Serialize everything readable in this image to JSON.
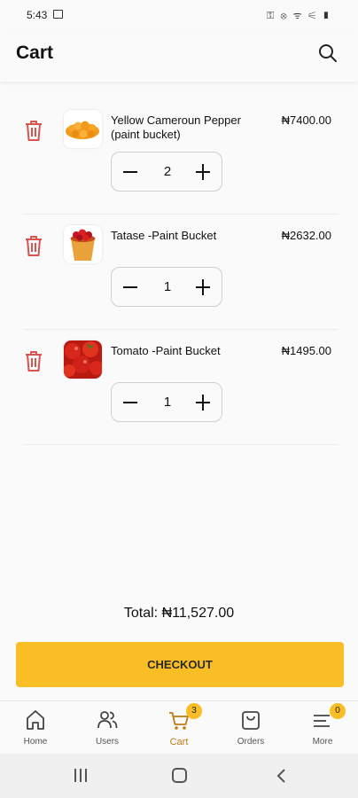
{
  "status_bar": {
    "time": "5:43",
    "right_icons": "⚿ ⊗ ᯤ ⚟ ▮"
  },
  "header": {
    "title": "Cart"
  },
  "cart": {
    "items": [
      {
        "name": "Yellow Cameroun Pepper (paint bucket)",
        "price": "₦7400.00",
        "quantity": "2"
      },
      {
        "name": "Tatase -Paint Bucket",
        "price": "₦2632.00",
        "quantity": "1"
      },
      {
        "name": "Tomato -Paint Bucket",
        "price": "₦1495.00",
        "quantity": "1"
      }
    ]
  },
  "summary": {
    "total": "Total: ₦11,527.00"
  },
  "checkout_label": "CHECKOUT",
  "nav": {
    "items": [
      {
        "label": "Home",
        "icon": "home-icon"
      },
      {
        "label": "Users",
        "icon": "users-icon"
      },
      {
        "label": "Cart",
        "icon": "cart-icon",
        "badge": "3",
        "active": true
      },
      {
        "label": "Orders",
        "icon": "orders-icon"
      },
      {
        "label": "More",
        "icon": "menu-icon",
        "badge": "0"
      }
    ]
  },
  "colors": {
    "accent": "#f9be25",
    "delete": "#d9534f",
    "active_nav": "#c07a10"
  }
}
